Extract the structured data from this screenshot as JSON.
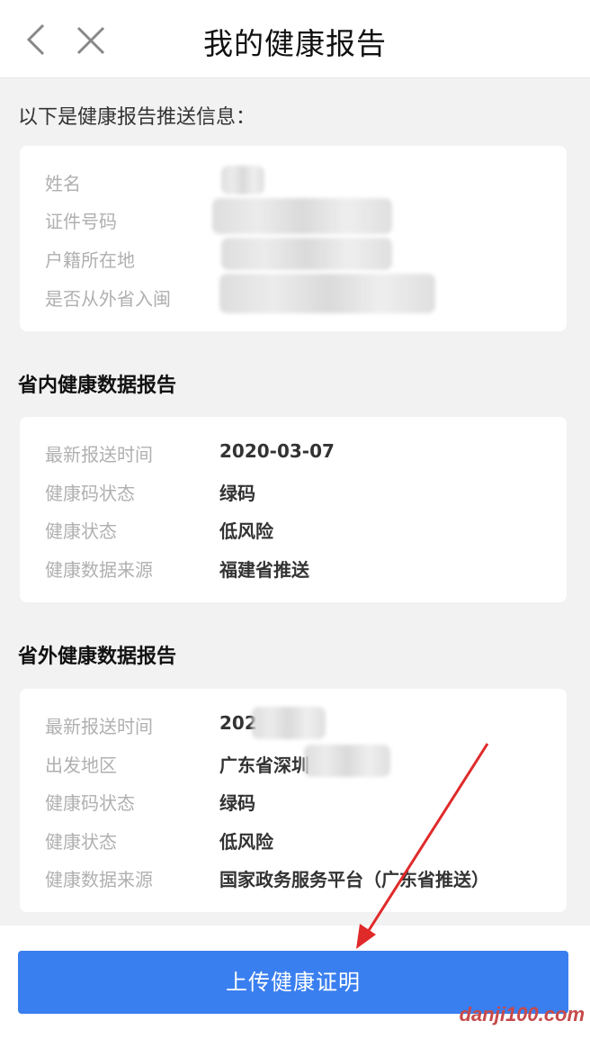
{
  "header": {
    "title": "我的健康报告"
  },
  "intro": "以下是健康报告推送信息：",
  "personal": {
    "rows": [
      {
        "label": "姓名",
        "value": ""
      },
      {
        "label": "证件号码",
        "value": ""
      },
      {
        "label": "户籍所在地",
        "value": ""
      },
      {
        "label": "是否从外省入闽",
        "value": ""
      }
    ]
  },
  "in_province": {
    "title": "省内健康数据报告",
    "rows": [
      {
        "label": "最新报送时间",
        "value": "2020-03-07"
      },
      {
        "label": "健康码状态",
        "value": "绿码"
      },
      {
        "label": "健康状态",
        "value": "低风险"
      },
      {
        "label": "健康数据来源",
        "value": "福建省推送"
      }
    ]
  },
  "out_province": {
    "title": "省外健康数据报告",
    "rows": [
      {
        "label": "最新报送时间",
        "value": "202"
      },
      {
        "label": "出发地区",
        "value": "广东省深圳"
      },
      {
        "label": "健康码状态",
        "value": "绿码"
      },
      {
        "label": "健康状态",
        "value": "低风险"
      },
      {
        "label": "健康数据来源",
        "value": "国家政务服务平台（广东省推送）"
      }
    ]
  },
  "footer": {
    "button_label": "上传健康证明"
  },
  "watermark": "danji100.com",
  "colors": {
    "accent": "#3a7ff0",
    "annotation_arrow": "#e02a2a"
  }
}
